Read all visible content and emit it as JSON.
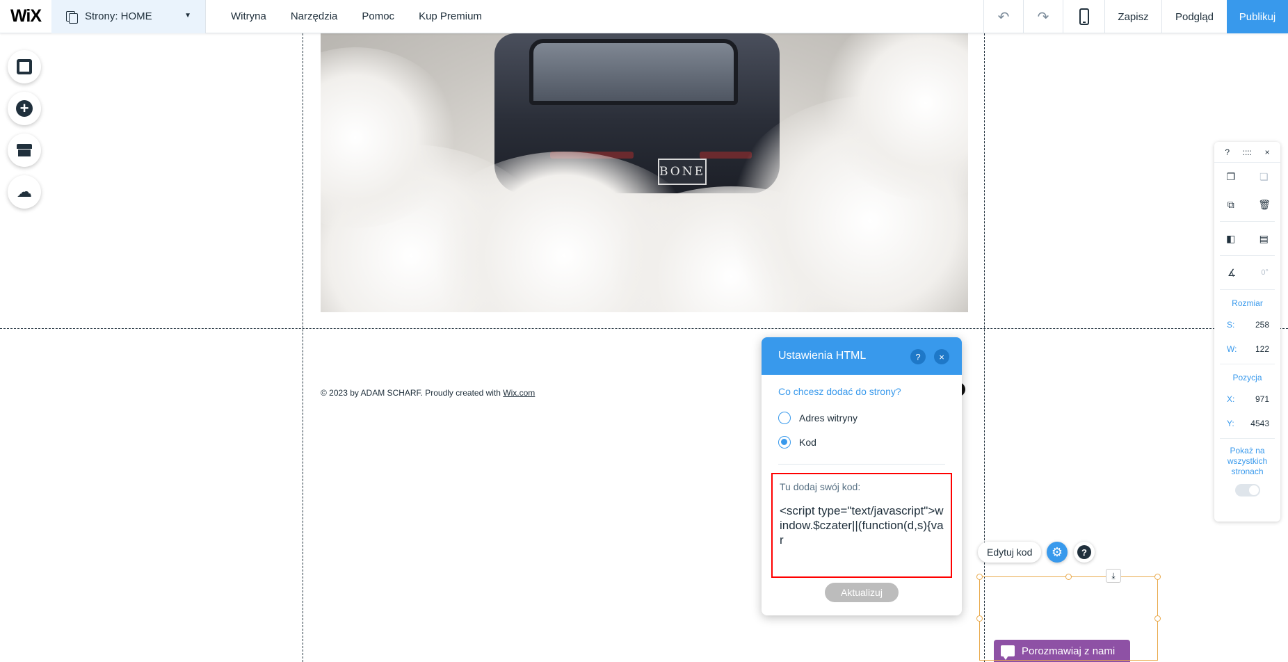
{
  "topbar": {
    "logo": "WiX",
    "pages_label": "Strony: HOME",
    "menu": [
      "Witryna",
      "Narzędzia",
      "Pomoc",
      "Kup Premium"
    ],
    "undo_icon": "undo-icon",
    "redo_icon": "redo-icon",
    "mobile_icon": "mobile-icon",
    "save": "Zapisz",
    "preview": "Podgląd",
    "publish": "Publikuj",
    "accent": "#3899ec"
  },
  "left_toolbar": {
    "items": [
      "background-icon",
      "add-icon",
      "store-icon",
      "upload-icon"
    ]
  },
  "hero": {
    "plate": "BONE"
  },
  "footer": {
    "text": "© 2023 by ADAM SCHARF. Proudly created with ",
    "link": "Wix.com"
  },
  "html_panel": {
    "title": "Ustawienia HTML",
    "help": "?",
    "close": "×",
    "question": "Co chcesz dodać do strony?",
    "options": [
      {
        "label": "Adres witryny",
        "checked": false
      },
      {
        "label": "Kod",
        "checked": true
      }
    ],
    "code_label": "Tu dodaj swój kod:",
    "code": "<script type=\"text/javascript\">window.$czater||(function(d,s){var",
    "update": "Aktualizuj"
  },
  "floating": {
    "edit_code": "Edytuj kod",
    "gear_icon": "gear-icon",
    "help": "?"
  },
  "chat": {
    "label": "Porozmawiaj z nami"
  },
  "right_panel": {
    "top": {
      "help": "?",
      "drag": "::::",
      "close": "×"
    },
    "size_title": "Rozmiar",
    "size": [
      {
        "k": "S:",
        "v": "258"
      },
      {
        "k": "W:",
        "v": "122"
      }
    ],
    "position_title": "Pozycja",
    "position": [
      {
        "k": "X:",
        "v": "971"
      },
      {
        "k": "Y:",
        "v": "4543"
      }
    ],
    "rotation": "0°",
    "show_all": "Pokaż na wszystkich stronach"
  }
}
